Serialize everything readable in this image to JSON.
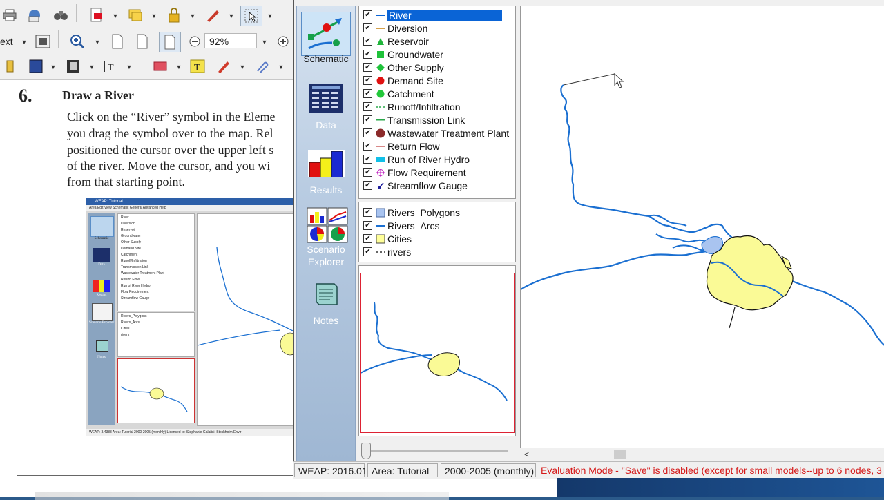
{
  "pdf": {
    "toolbar": {
      "text_label": "ext",
      "zoom_value": "92%",
      "icons": [
        "print-icon",
        "email-icon",
        "binoculars-icon",
        "pdf-create-icon",
        "comment-icon",
        "lock-icon",
        "pen-sign-icon",
        "select-tool-icon",
        "zoom-in-icon",
        "page-icon",
        "page-icon",
        "page-fit-icon",
        "zoom-out-icon",
        "zoom-plus-icon",
        "attach-icon",
        "shape-icon",
        "film-icon",
        "text-tool-icon",
        "rectangle-icon",
        "text-highlight-icon",
        "pencil-icon",
        "paperclip-icon"
      ]
    },
    "page": {
      "step_number": "6.",
      "step_title": "Draw a River",
      "lines": [
        "Click on the “River” symbol in the Eleme",
        "you drag the symbol over to the map. Rel",
        "positioned the cursor over the upper left s",
        "of the river.  Move the cursor, and you wi",
        "from that starting point."
      ]
    },
    "embedded_screenshot": {
      "title": "WEAP: Tutorial",
      "menu": "Area  Edit  View  Schematic  General  Advanced  Help",
      "nav": [
        "Schematic",
        "Data",
        "Results",
        "Scenario Explorer",
        "Notes"
      ],
      "legend": [
        "River",
        "Diversion",
        "Reservoir",
        "Groundwater",
        "Other Supply",
        "Demand Site",
        "Catchment",
        "Runoff/Infiltration",
        "Transmission Link",
        "Wastewater Treatment Plant",
        "Return Flow",
        "Run of River Hydro",
        "Flow Requirement",
        "Streamflow Gauge"
      ],
      "layers": [
        "Rivers_Polygons",
        "Rivers_Arcs",
        "Cities",
        "rivers"
      ],
      "status": "WEAP: 3.4388    Area: Tutorial    2000-2005 (monthly)    Licensed to: Stephanie Galaitsi, Stockholm Envir"
    }
  },
  "weap": {
    "nav": {
      "schematic": "Schematic",
      "data": "Data",
      "results": "Results",
      "scenario_explorer": "Scenario Explorer",
      "notes": "Notes"
    },
    "legend": [
      {
        "label": "River",
        "symbol": "river-line",
        "color": "#0a64d6",
        "checked": true,
        "selected": true
      },
      {
        "label": "Diversion",
        "symbol": "diversion-line",
        "color": "#d4a04a",
        "checked": true
      },
      {
        "label": "Reservoir",
        "symbol": "triangle",
        "color": "#1fb53a",
        "checked": true
      },
      {
        "label": "Groundwater",
        "symbol": "square",
        "color": "#1fc23a",
        "checked": true
      },
      {
        "label": "Other Supply",
        "symbol": "diamond",
        "color": "#1fc23a",
        "checked": true
      },
      {
        "label": "Demand Site",
        "symbol": "circle",
        "color": "#e01010",
        "checked": true
      },
      {
        "label": "Catchment",
        "symbol": "circle",
        "color": "#22c83a",
        "checked": true
      },
      {
        "label": "Runoff/Infiltration",
        "symbol": "dashed-line",
        "color": "#2aa84a",
        "checked": true
      },
      {
        "label": "Transmission Link",
        "symbol": "line",
        "color": "#2aa84a",
        "checked": true
      },
      {
        "label": "Wastewater Treatment Plant",
        "symbol": "circle",
        "color": "#8b2a2a",
        "checked": true
      },
      {
        "label": "Return Flow",
        "symbol": "line",
        "color": "#b01010",
        "checked": true
      },
      {
        "label": "Run of River Hydro",
        "symbol": "rect",
        "color": "#11c0e8",
        "checked": true
      },
      {
        "label": "Flow Requirement",
        "symbol": "crosshair",
        "color": "#c020c0",
        "checked": true
      },
      {
        "label": "Streamflow Gauge",
        "symbol": "gauge",
        "color": "#1a1a9a",
        "checked": true
      }
    ],
    "layers": [
      {
        "label": "Rivers_Polygons",
        "symbol": "square",
        "color": "#a9c4f0",
        "checked": true
      },
      {
        "label": "Rivers_Arcs",
        "symbol": "line",
        "color": "#1a6fd1",
        "checked": true
      },
      {
        "label": "Cities",
        "symbol": "square",
        "color": "#ffff99",
        "checked": true
      },
      {
        "label": "rivers",
        "symbol": "dashed-line",
        "color": "#333333",
        "checked": true
      }
    ],
    "status": {
      "version": "WEAP: 2016.01",
      "area": "Area: Tutorial",
      "period": "2000-2005 (monthly)",
      "evaluation": "Evaluation Mode - \"Save\" is disabled (except for small models--up to 6 nodes, 3"
    },
    "colors": {
      "river": "#1a6fd1",
      "city_fill": "#fafa96",
      "selection": "#0a64d6",
      "eval_text": "#d51a1a"
    }
  }
}
